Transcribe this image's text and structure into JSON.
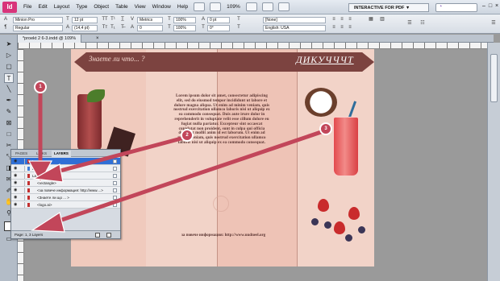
{
  "menu": {
    "logo": "Id",
    "items": [
      "File",
      "Edit",
      "Layout",
      "Type",
      "Object",
      "Table",
      "View",
      "Window",
      "Help"
    ],
    "zoom": "109%",
    "workspace": "INTERACTIVE FOR PDF",
    "workspace_arrow": "▼"
  },
  "control": {
    "font_family": "Minion Pro",
    "font_style": "Regular",
    "font_size": "12 pt",
    "leading": "(14,4 pt)",
    "kerning": "Metrics",
    "tracking": "0",
    "tracking2": "0",
    "scale_h": "100%",
    "scale_v": "100%",
    "baseline": "0 pt",
    "skew": "0°",
    "style": "[None]",
    "char_style": "[No character style]",
    "language": "English: USA"
  },
  "document": {
    "tab_title": "*proekt 2 6-3.indd @ 109%",
    "close": "×"
  },
  "spread": {
    "banner_left": "Знаете ли что... ?",
    "banner_right": "ДИКУЧЧЧТ",
    "body_text": "Lorem ipsum dolor sit amet, consectetur adipiscing elit, sed do eiusmod tempor incididunt ut labore et dolore magna aliqua. Ut enim ad minim veniam, quis nostrud exercitation ullamco laboris nisi ut aliquip ex ea commodo consequat. Duis aute irure dolor in reprehenderit in voluptate velit esse cillum dolore eu fugiat nulla pariatur. Excepteur sint occaecat cupidatat non proident, sunt in culpa qui officia deserunt mollit anim id est laborum. Ut enim ad minim veniam, quis nostrud exercitation ullamco laboris nisi ut aliquip ex ea commodo consequat.",
    "footer": "за повече информация: http://www.uudneel.org"
  },
  "layers_panel": {
    "tabs": [
      "PAGES",
      "LINKS",
      "LAYERS"
    ],
    "active_tab": "LAYERS",
    "rows": [
      {
        "name": "Logo"
      },
      {
        "name": "Layer 1"
      },
      {
        "name": "Layer"
      },
      {
        "name": "<rectangle>"
      },
      {
        "name": "<за повече информация: http://www....>"
      },
      {
        "name": "<Знаете ли що ... >"
      },
      {
        "name": "<logo.ai>"
      }
    ],
    "footer": "Page: 1, 3 Layers"
  },
  "annotations": [
    "1",
    "2",
    "3"
  ],
  "colors": {
    "banner": "#7c4340",
    "callout": "#c2465a",
    "selected_layer": "#2f6fd6"
  }
}
